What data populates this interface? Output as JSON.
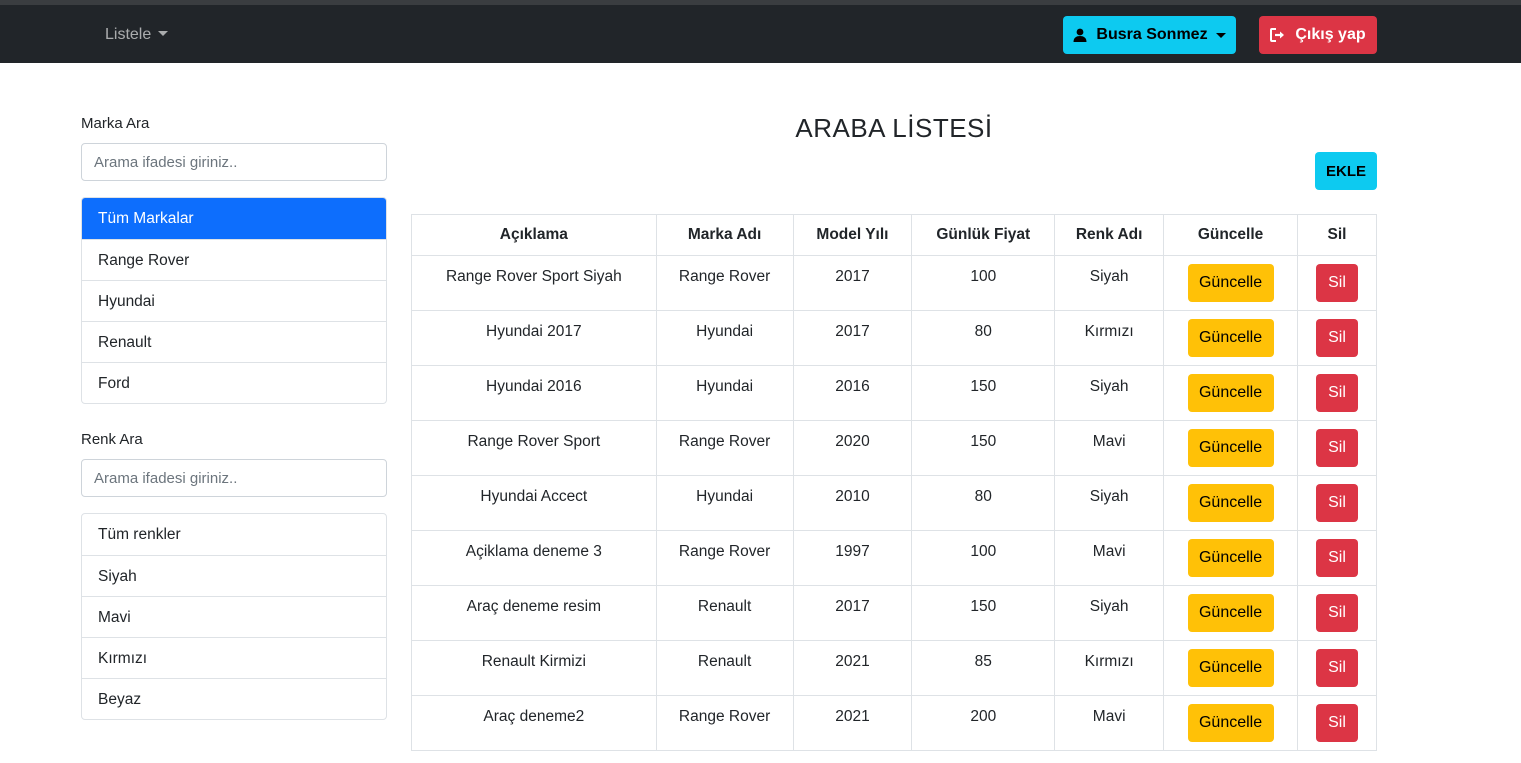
{
  "navbar": {
    "menu_label": "Listele",
    "user_label": "Busra Sonmez",
    "logout_label": "Çıkış yap"
  },
  "sidebar": {
    "brand_label": "Marka Ara",
    "brand_placeholder": "Arama ifadesi giriniz..",
    "brands": [
      "Tüm Markalar",
      "Range Rover",
      "Hyundai",
      "Renault",
      "Ford"
    ],
    "active_brand": 0,
    "color_label": "Renk Ara",
    "color_placeholder": "Arama ifadesi giriniz..",
    "colors": [
      "Tüm renkler",
      "Siyah",
      "Mavi",
      "Kırmızı",
      "Beyaz"
    ]
  },
  "main": {
    "title": "ARABA LİSTESİ",
    "add_label": "EKLE",
    "columns": [
      "Açıklama",
      "Marka Adı",
      "Model Yılı",
      "Günlük Fiyat",
      "Renk Adı",
      "Güncelle",
      "Sil"
    ],
    "update_label": "Güncelle",
    "delete_label": "Sil",
    "rows": [
      {
        "description": "Range Rover Sport Siyah",
        "brand": "Range Rover",
        "year": "2017",
        "price": "100",
        "color": "Siyah"
      },
      {
        "description": "Hyundai 2017",
        "brand": "Hyundai",
        "year": "2017",
        "price": "80",
        "color": "Kırmızı"
      },
      {
        "description": "Hyundai 2016",
        "brand": "Hyundai",
        "year": "2016",
        "price": "150",
        "color": "Siyah"
      },
      {
        "description": "Range Rover Sport",
        "brand": "Range Rover",
        "year": "2020",
        "price": "150",
        "color": "Mavi"
      },
      {
        "description": "Hyundai Accect",
        "brand": "Hyundai",
        "year": "2010",
        "price": "80",
        "color": "Siyah"
      },
      {
        "description": "Açiklama deneme 3",
        "brand": "Range Rover",
        "year": "1997",
        "price": "100",
        "color": "Mavi"
      },
      {
        "description": "Araç deneme resim",
        "brand": "Renault",
        "year": "2017",
        "price": "150",
        "color": "Siyah"
      },
      {
        "description": "Renault Kirmizi",
        "brand": "Renault",
        "year": "2021",
        "price": "85",
        "color": "Kırmızı"
      },
      {
        "description": "Araç deneme2",
        "brand": "Range Rover",
        "year": "2021",
        "price": "200",
        "color": "Mavi"
      }
    ]
  },
  "icons": {
    "user": "user-icon",
    "logout": "logout-icon",
    "dropdown": "caret-down-icon"
  },
  "colors": {
    "navbar": "#212529",
    "info": "#0dcaf0",
    "danger": "#dc3545",
    "warning": "#ffc107",
    "primary": "#0d6efd"
  }
}
